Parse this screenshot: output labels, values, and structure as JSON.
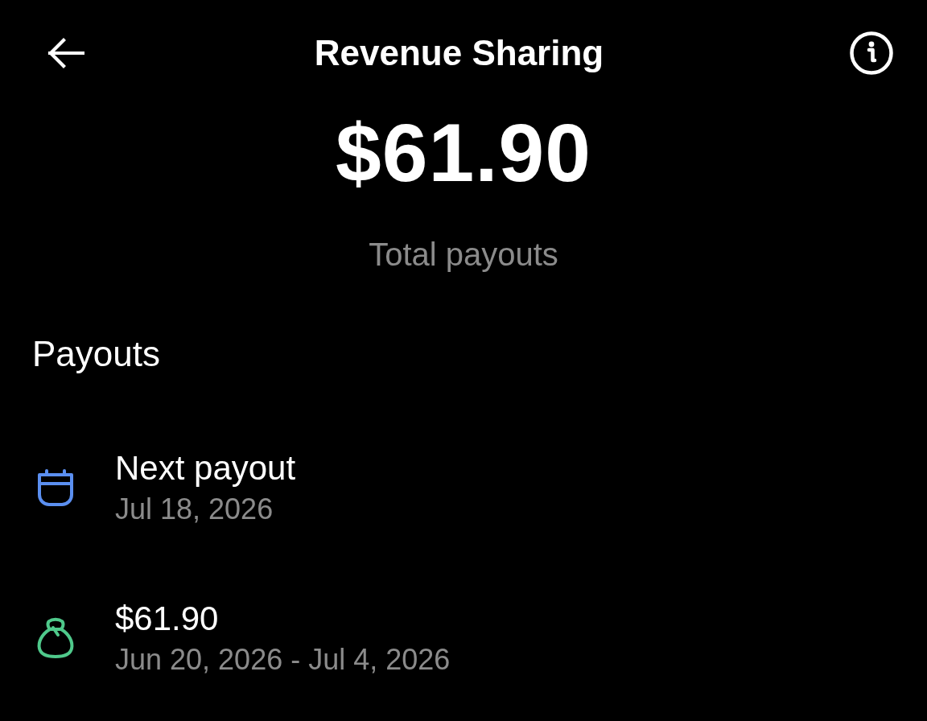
{
  "header": {
    "title": "Revenue Sharing"
  },
  "summary": {
    "amount": "$61.90",
    "label": "Total payouts"
  },
  "payouts": {
    "heading": "Payouts",
    "items": [
      {
        "kind": "calendar",
        "title": "Next payout",
        "subtitle": "Jul 18, 2026"
      },
      {
        "kind": "bag",
        "title": "$61.90",
        "subtitle": "Jun 20, 2026 - Jul 4, 2026"
      }
    ]
  }
}
